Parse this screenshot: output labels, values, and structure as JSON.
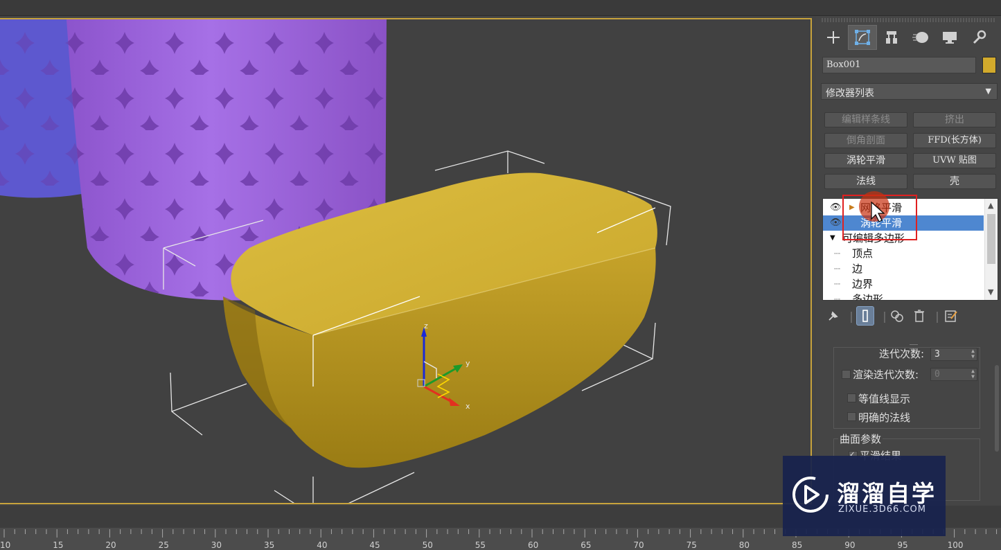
{
  "command_panel": {
    "tabs": [
      {
        "name": "create-tab",
        "icon": "plus-icon"
      },
      {
        "name": "modify-tab",
        "icon": "modify-icon"
      },
      {
        "name": "hierarchy-tab",
        "icon": "hierarchy-icon"
      },
      {
        "name": "motion-tab",
        "icon": "motion-icon"
      },
      {
        "name": "display-tab",
        "icon": "display-icon"
      },
      {
        "name": "utilities-tab",
        "icon": "wrench-icon"
      }
    ],
    "object_name": "Box001",
    "object_color": "#d2aa2c",
    "modifier_list_label": "修改器列表",
    "modifier_buttons": [
      {
        "label": "编辑样条线",
        "disabled": true
      },
      {
        "label": "挤出",
        "disabled": true
      },
      {
        "label": "倒角剖面",
        "disabled": true
      },
      {
        "label": "FFD(长方体)",
        "disabled": false
      },
      {
        "label": "涡轮平滑",
        "disabled": false
      },
      {
        "label": "UVW 贴图",
        "disabled": false
      },
      {
        "label": "法线",
        "disabled": false
      },
      {
        "label": "壳",
        "disabled": false
      }
    ],
    "stack": [
      {
        "label": "网格平滑",
        "selected": false
      },
      {
        "label": "涡轮平滑",
        "selected": true
      },
      {
        "label": "可编辑多边形",
        "selected": false
      },
      {
        "label": "顶点",
        "selected": false
      },
      {
        "label": "边",
        "selected": false
      },
      {
        "label": "边界",
        "selected": false
      },
      {
        "label": "多边形",
        "selected": false
      }
    ],
    "rollout": {
      "iterations_label": "迭代次数:",
      "iterations_value": "3",
      "render_iterations_label": "渲染迭代次数:",
      "render_iterations_value": "0",
      "isoline_label": "等值线显示",
      "explicit_normals_label": "明确的法线",
      "surface_params_label": "曲面参数",
      "smooth_result_label": "平滑结果"
    }
  },
  "timeline": {
    "ticks": [
      "10",
      "15",
      "20",
      "25",
      "30",
      "35",
      "40",
      "45",
      "50",
      "55",
      "60",
      "65",
      "70",
      "75",
      "80",
      "85",
      "90",
      "95",
      "100"
    ]
  },
  "gizmo": {
    "x_label": "x",
    "y_label": "y",
    "z_label": "z"
  },
  "watermark": {
    "title": "溜溜自学",
    "subtitle": "ZIXUE.3D66.COM"
  },
  "colors": {
    "accent": "#c8a33c",
    "selection": "#4e87d0",
    "highlight_box": "#e02020"
  }
}
